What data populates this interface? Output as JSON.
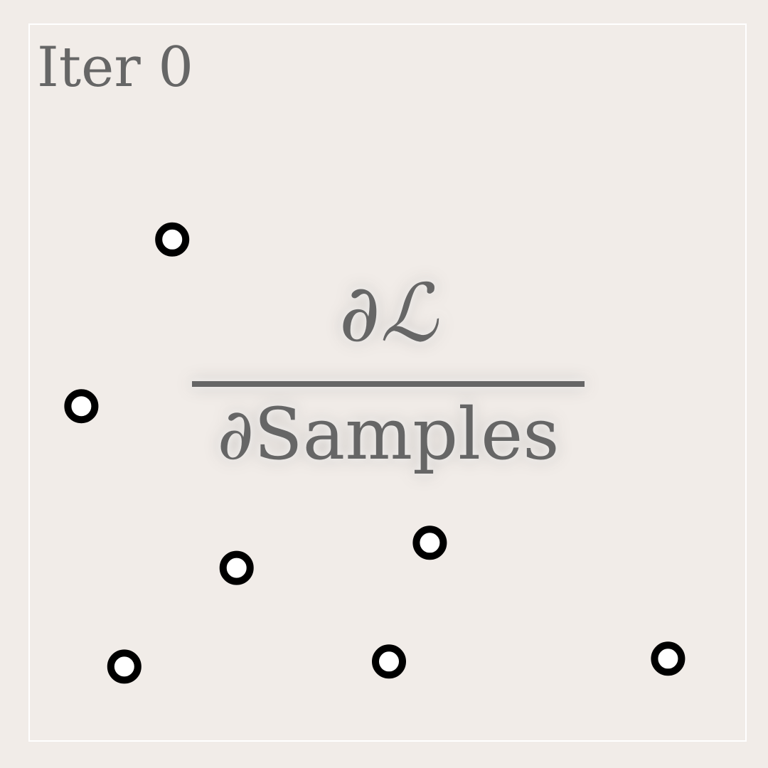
{
  "title": "Iter 0",
  "fraction": {
    "numerator": "∂ℒ",
    "denominator_partial": "∂",
    "denominator_text": "Samples"
  },
  "chart_data": {
    "type": "scatter",
    "title": "Iter 0",
    "xlim": [
      0,
      1
    ],
    "ylim": [
      0,
      1
    ],
    "grid": false,
    "points": [
      {
        "x": 0.199,
        "y": 0.7
      },
      {
        "x": 0.072,
        "y": 0.467
      },
      {
        "x": 0.289,
        "y": 0.241
      },
      {
        "x": 0.559,
        "y": 0.276
      },
      {
        "x": 0.132,
        "y": 0.103
      },
      {
        "x": 0.502,
        "y": 0.11
      },
      {
        "x": 0.892,
        "y": 0.114
      }
    ],
    "marker_color": "#000000",
    "marker_fill": "#ffffff"
  }
}
